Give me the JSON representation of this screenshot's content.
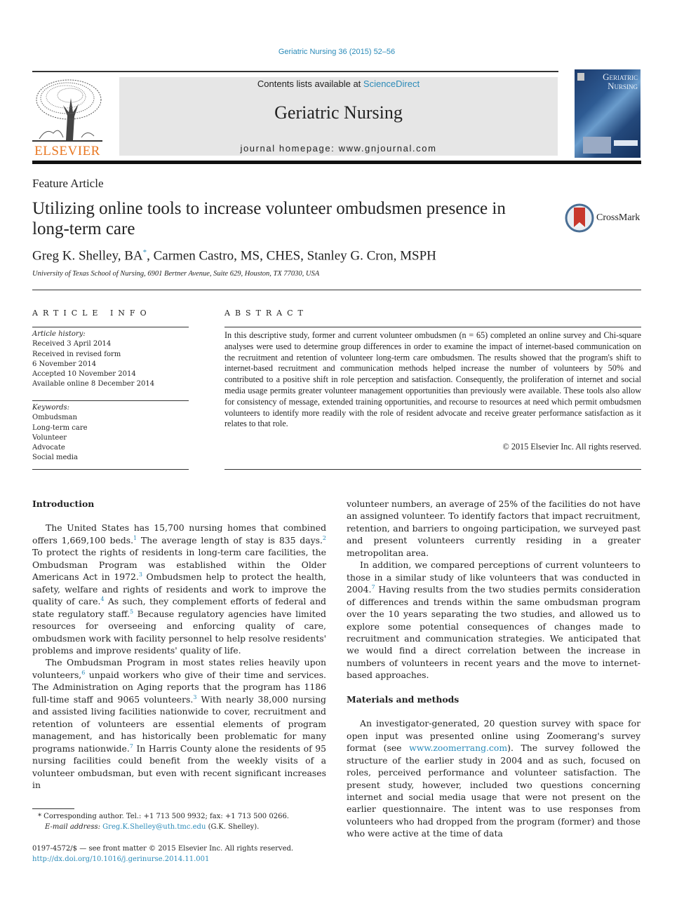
{
  "header": {
    "citation": "Geriatric Nursing 36 (2015) 52–56",
    "contents_prefix": "Contents lists available at ",
    "contents_link": "ScienceDirect",
    "journal_title": "Geriatric Nursing",
    "homepage_label": "journal homepage: www.gnjournal.com",
    "publisher_logo": "ELSEVIER",
    "cover_title_line1": "Geriatric",
    "cover_title_line2": "Nursing"
  },
  "article": {
    "type": "Feature Article",
    "title": "Utilizing online tools to increase volunteer ombudsmen presence in long-term care",
    "crossmark_label": "CrossMark",
    "authors": [
      {
        "name": "Greg K. Shelley, BA",
        "mark": "*"
      },
      {
        "name": "Carmen Castro, MS, CHES"
      },
      {
        "name": "Stanley G. Cron, MSPH"
      }
    ],
    "affiliation": "University of Texas School of Nursing, 6901 Bertner Avenue, Suite 629, Houston, TX 77030, USA"
  },
  "article_info": {
    "heading": "ARTICLE INFO",
    "history_heading": "Article history:",
    "history": [
      "Received 3 April 2014",
      "Received in revised form",
      "6 November 2014",
      "Accepted 10 November 2014",
      "Available online 8 December 2014"
    ],
    "keywords_heading": "Keywords:",
    "keywords": [
      "Ombudsman",
      "Long-term care",
      "Volunteer",
      "Advocate",
      "Social media"
    ]
  },
  "abstract": {
    "heading": "ABSTRACT",
    "text": "In this descriptive study, former and current volunteer ombudsmen (n = 65) completed an online survey and Chi-square analyses were used to determine group differences in order to examine the impact of internet-based communication on the recruitment and retention of volunteer long-term care ombudsmen. The results showed that the program's shift to internet-based recruitment and communication methods helped increase the number of volunteers by 50% and contributed to a positive shift in role perception and satisfaction. Consequently, the proliferation of internet and social media usage permits greater volunteer management opportunities than previously were available. These tools also allow for consistency of message, extended training opportunities, and recourse to resources at need which permit ombudsmen volunteers to identify more readily with the role of resident advocate and receive greater performance satisfaction as it relates to that role.",
    "copyright": "© 2015 Elsevier Inc. All rights reserved."
  },
  "body": {
    "intro_heading": "Introduction",
    "intro_p1": [
      {
        "t": "The United States has 15,700 nursing homes that combined offers 1,669,100 beds."
      },
      {
        "ref": "1"
      },
      {
        "t": " The average length of stay is 835 days."
      },
      {
        "ref": "2"
      },
      {
        "t": " To protect the rights of residents in long-term care facilities, the Ombudsman Program was established within the Older Americans Act in 1972."
      },
      {
        "ref": "3"
      },
      {
        "t": " Ombudsmen help to protect the health, safety, welfare and rights of residents and work to improve the quality of care."
      },
      {
        "ref": "4"
      },
      {
        "t": " As such, they complement efforts of federal and state regulatory staff."
      },
      {
        "ref": "5"
      },
      {
        "t": " Because regulatory agencies have limited resources for overseeing and enforcing quality of care, ombudsmen work with facility personnel to help resolve residents' problems and improve residents' quality of life."
      }
    ],
    "intro_p2": [
      {
        "t": "The Ombudsman Program in most states relies heavily upon volunteers,"
      },
      {
        "ref": "6"
      },
      {
        "t": " unpaid workers who give of their time and services. The Administration on Aging reports that the program has 1186 full-time staff and 9065 volunteers."
      },
      {
        "ref": "3"
      },
      {
        "t": " With nearly 38,000 nursing and assisted living facilities nationwide to cover, recruitment and retention of volunteers are essential elements of program management, and has historically been problematic for many programs nationwide."
      },
      {
        "ref": "7"
      },
      {
        "t": " In Harris County alone the residents of 95 nursing facilities could benefit from the weekly visits of a volunteer ombudsman, but even with recent significant increases in volunteer numbers, an average of 25% of the facilities do not have an assigned volunteer. To identify factors that impact recruitment, retention, and barriers to ongoing participation, we surveyed past and present volunteers currently residing in a greater metropolitan area."
      }
    ],
    "intro_p3": [
      {
        "t": "In addition, we compared perceptions of current volunteers to those in a similar study of like volunteers that was conducted in 2004."
      },
      {
        "ref": "7"
      },
      {
        "t": " Having results from the two studies permits consideration of differences and trends within the same ombudsman program over the 10 years separating the two studies, and allowed us to explore some potential consequences of changes made to recruitment and communication strategies. We anticipated that we would find a direct correlation between the increase in numbers of volunteers in recent years and the move to internet-based approaches."
      }
    ],
    "methods_heading": "Materials and methods",
    "methods_p1": [
      {
        "t": "An investigator-generated, 20 question survey with space for open input was presented online using Zoomerang's survey format (see "
      },
      {
        "link": "www.zoomerrang.com"
      },
      {
        "t": "). The survey followed the structure of the earlier study in 2004 and as such, focused on roles, perceived performance and volunteer satisfaction. The present study, however, included two questions concerning internet and social media usage that were not present on the earlier questionnaire. The intent was to use responses from volunteers who had dropped from the program (former) and those who were active at the time of data"
      }
    ]
  },
  "footnotes": {
    "corresponding": "* Corresponding author. Tel.: +1 713 500 9932; fax: +1 713 500 0266.",
    "email_label": "E-mail address:",
    "email": "Greg.K.Shelley@uth.tmc.edu",
    "email_suffix": " (G.K. Shelley).",
    "issn_line": "0197-4572/$ — see front matter © 2015 Elsevier Inc. All rights reserved.",
    "doi": "http://dx.doi.org/10.1016/j.gerinurse.2014.11.001"
  },
  "colors": {
    "link": "#2a8ab8",
    "elsevier_orange": "#e87722",
    "masthead_bg": "#e6e6e6"
  }
}
